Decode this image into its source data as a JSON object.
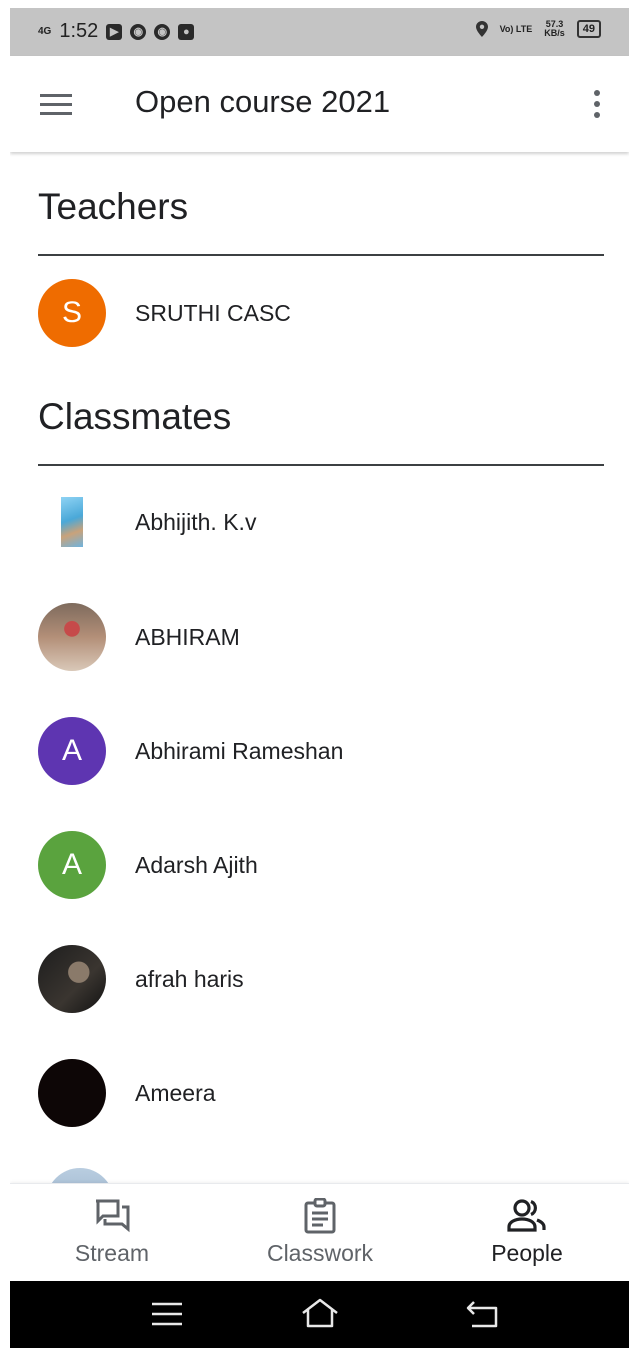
{
  "status_bar": {
    "network": "4G",
    "time": "1:52",
    "notification_icons": [
      "youtube-icon",
      "chrome-icon",
      "chrome-icon",
      "recorder-icon"
    ],
    "volte": "Vo) LTE",
    "speed_value": "57.3",
    "speed_unit": "KB/s",
    "battery": "49"
  },
  "app_bar": {
    "title": "Open course 2021"
  },
  "teachers": {
    "heading": "Teachers",
    "people": [
      {
        "name": "SRUTHI CASC",
        "initial": "S",
        "color": "#ef6c00"
      }
    ]
  },
  "classmates": {
    "heading": "Classmates",
    "people": [
      {
        "name": "Abhijith. K.v",
        "avatar": "photo"
      },
      {
        "name": "ABHIRAM",
        "avatar": "photo"
      },
      {
        "name": "Abhirami Rameshan",
        "initial": "A",
        "color": "#5e35b1"
      },
      {
        "name": "Adarsh Ajith",
        "initial": "A",
        "color": "#5aa33e"
      },
      {
        "name": "afrah haris",
        "avatar": "photo"
      },
      {
        "name": "Ameera",
        "avatar": "photo"
      }
    ]
  },
  "bottom_nav": {
    "tabs": [
      {
        "label": "Stream",
        "icon": "stream-icon",
        "active": false
      },
      {
        "label": "Classwork",
        "icon": "classwork-icon",
        "active": false
      },
      {
        "label": "People",
        "icon": "people-icon",
        "active": true
      }
    ]
  },
  "colors": {
    "status_bar_bg": "#c4c4c4",
    "text_primary": "#202124",
    "icon_gray": "#5f6368"
  }
}
